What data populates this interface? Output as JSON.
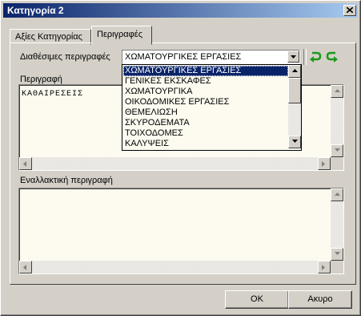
{
  "window": {
    "title": "Κατηγορία 2"
  },
  "tabs": [
    {
      "label": "Αξίες Κατηγορίας"
    },
    {
      "label": "Περιγραφές"
    }
  ],
  "descriptions": {
    "available_label": "Διαθέσιμες περιγραφές",
    "selected": "ΧΩΜΑΤΟΥΡΓΙΚΕΣ ΕΡΓΑΣΙΕΣ",
    "options": [
      "ΧΩΜΑΤΟΥΡΓΙΚΕΣ ΕΡΓΑΣΙΕΣ",
      "ΓΕΝΙΚΕΣ ΕΚΣΚΑΦΕΣ",
      "ΧΩΜΑΤΟΥΡΓΙΚΑ",
      "ΟΙΚΟΔΟΜΙΚΕΣ ΕΡΓΑΣΙΕΣ",
      "ΘΕΜΕΛΙΩΣΗ",
      "ΣΚΥΡΟΔΕΜΑΤΑ",
      "ΤΟΙΧΟΔΟΜΕΣ",
      "ΚΑΛΥΨΕΙΣ"
    ],
    "description_label": "Περιγραφή",
    "description_value": "ΚΑΘΑΙΡΕΣΕΙΣ",
    "alt_label": "Εναλλακτική περιγραφή",
    "alt_value": ""
  },
  "icons": {
    "undo": "undo-arrow-icon",
    "redo": "redo-arrow-icon",
    "accent": "#1a9a1a"
  },
  "buttons": {
    "ok": "OK",
    "cancel": "Ακυρο"
  }
}
